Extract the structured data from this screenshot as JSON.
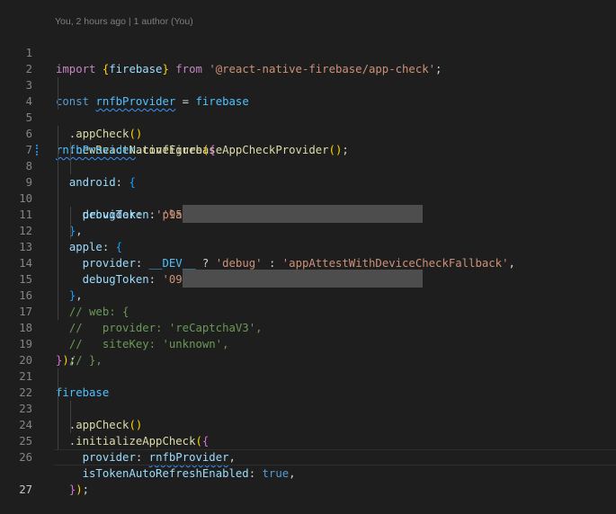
{
  "blame": "You, 2 hours ago | 1 author (You)",
  "code": {
    "import_kw": "import",
    "from_kw": "from",
    "module": "'@react-native-firebase/app-check'",
    "const_kw": "const",
    "provider_var": "rnfbProvider",
    "firebase": "firebase",
    "appCheck": "appCheck",
    "newProvider": "newReactNativeFirebaseAppCheckProvider",
    "configure": "configure",
    "android": "android",
    "provider_key": "provider",
    "playIntegrity": "'playIntegrity'",
    "debugToken_key": "debugToken",
    "android_token_prefix": "'95",
    "apple": "apple",
    "dev": "__DEV__",
    "debug": "'debug'",
    "appAttest": "'appAttestWithDeviceCheckFallback'",
    "apple_token_prefix": "'09",
    "c1": "// web: {",
    "c2": "//   provider: 'reCaptchaV3',",
    "c3": "//   siteKey: 'unknown',",
    "c4": "// },",
    "initializeAppCheck": "initializeAppCheck",
    "isTokenAutoRefreshEnabled": "isTokenAutoRefreshEnabled",
    "true_kw": "true"
  },
  "line_numbers": [
    "1",
    "2",
    "3",
    "4",
    "5",
    "6",
    "7",
    "8",
    "9",
    "10",
    "11",
    "12",
    "13",
    "14",
    "15",
    "16",
    "17",
    "18",
    "19",
    "20",
    "21",
    "22",
    "23",
    "24",
    "25",
    "26",
    "27"
  ]
}
